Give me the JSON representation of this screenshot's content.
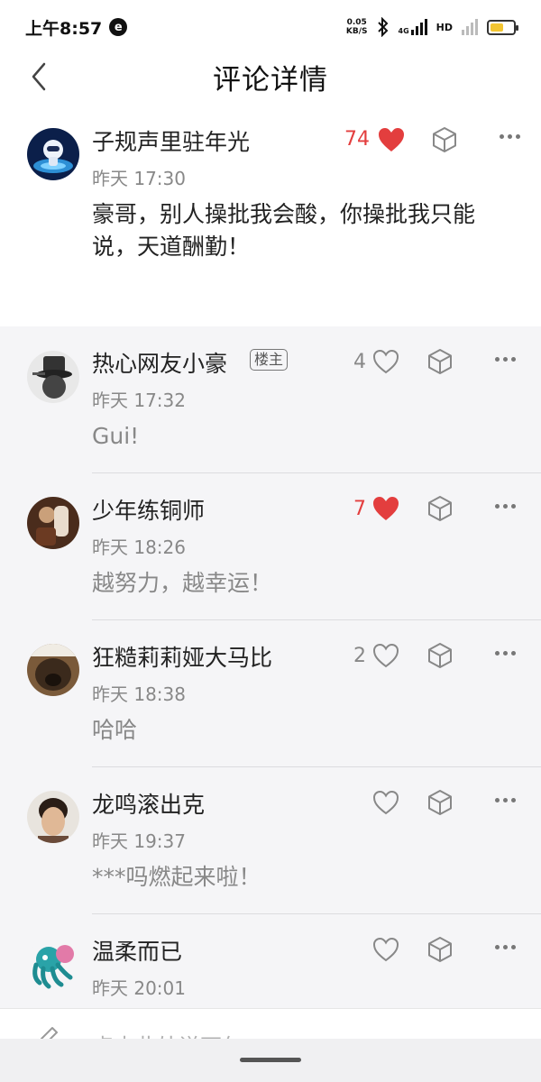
{
  "status_bar": {
    "time": "上午8:57",
    "net_speed_value": "0.05",
    "net_speed_unit": "KB/S",
    "network_type": "4G",
    "hd": "HD",
    "battery_level": 0.6
  },
  "header": {
    "title": "评论详情"
  },
  "main_comment": {
    "name": "子规声里驻年光",
    "time": "昨天 17:30",
    "content": "豪哥，别人操批我会酸，你操批我只能说，天道酬勤！",
    "likes": "74",
    "liked": true
  },
  "replies": [
    {
      "name": "热心网友小豪",
      "badge": "楼主",
      "time": "昨天 17:32",
      "content": "Gui!",
      "likes": "4",
      "liked": false
    },
    {
      "name": "少年练铜师",
      "time": "昨天 18:26",
      "content": "越努力，越幸运！",
      "likes": "7",
      "liked": true
    },
    {
      "name": "狂糙莉莉娅大马比",
      "time": "昨天 18:38",
      "content": "哈哈",
      "likes": "2",
      "liked": false
    },
    {
      "name": "龙鸣滚出克",
      "time": "昨天 19:37",
      "content": "***吗燃起来啦！",
      "likes": "",
      "liked": false
    },
    {
      "name": "温柔而已",
      "time": "昨天 20:01",
      "content": "",
      "likes": "",
      "liked": false
    }
  ],
  "input": {
    "placeholder": "点击此处说两句"
  },
  "colors": {
    "like_red": "#e33e3e",
    "reply_bg": "#f5f5f7",
    "battery_yellow": "#f3c531"
  }
}
